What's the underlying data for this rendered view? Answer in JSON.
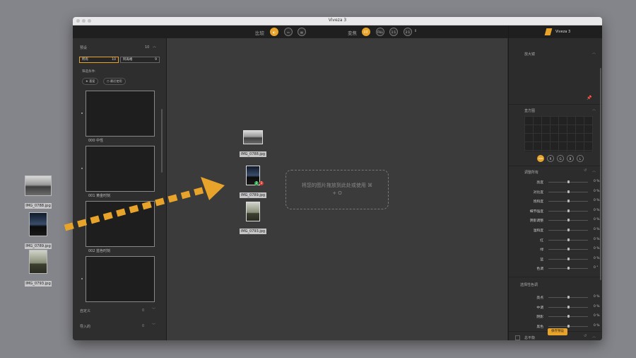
{
  "window": {
    "title": "Viveza 3"
  },
  "toolbar": {
    "compare_label": "比较",
    "transform_label": "变焦",
    "zoom_fit": "FIT",
    "zoom_fill": "FILL",
    "zoom_1to1": "1:1",
    "zoom_2to1": "2:1",
    "stepper": "⇕"
  },
  "desktop_files": [
    "IMG_0788.jpg",
    "IMG_0789.jpg",
    "IMG_0793.jpg"
  ],
  "left_panel": {
    "presets_header": "预设",
    "presets_count": "10",
    "seg_all_label": "所有",
    "seg_all_count": "10",
    "seg_nik_label": "阿再格",
    "seg_nik_count": "9",
    "filter_label": "筛选条件:",
    "chip_favorites": "★ 喜爱",
    "chip_recent": "◷ 最近使用",
    "presets": [
      "000 中性",
      "001 黄金时刻",
      "002 蓝色时刻"
    ],
    "custom_label": "自定义",
    "custom_count": "0",
    "imported_label": "导入的",
    "imported_count": "0"
  },
  "center": {
    "thumbs": [
      "IMG_0788.jpg",
      "IMG_0789.jpg",
      "IMG_0793.jpg"
    ],
    "drop_text_1": "将您的图片拖放到此处或使用 ⌘",
    "drop_text_2": "+ O",
    "badge_green": "2",
    "badge_red": "3"
  },
  "right_panel": {
    "title": "Viveza 3",
    "loupe_label": "放大镜",
    "histogram_label": "直方图",
    "channels": [
      "RGB",
      "R",
      "G",
      "B",
      "L"
    ],
    "adjust_all_label": "调整所有",
    "sliders": [
      {
        "label": "亮度",
        "value": "0 %"
      },
      {
        "label": "对比度",
        "value": "0 %"
      },
      {
        "label": "饱和度",
        "value": "0 %"
      },
      {
        "label": "细节强度",
        "value": "0 %"
      },
      {
        "label": "阴影调整",
        "value": "0 %"
      },
      {
        "label": "温和度",
        "value": "0 %"
      },
      {
        "label": "红",
        "value": "0 %"
      },
      {
        "label": "绿",
        "value": "0 %"
      },
      {
        "label": "蓝",
        "value": "0 %"
      },
      {
        "label": "色调",
        "value": "0 °"
      }
    ],
    "selective_label": "选择性色调",
    "tone_sliders": [
      {
        "label": "亮点",
        "value": "0 %"
      },
      {
        "label": "中调",
        "value": "0 %"
      },
      {
        "label": "阴影",
        "value": "0 %"
      },
      {
        "label": "黑色",
        "value": "0 %"
      }
    ],
    "footer_label": "总平衡",
    "save_button": "保存预设"
  },
  "colors": {
    "accent": "#e8a42a"
  }
}
